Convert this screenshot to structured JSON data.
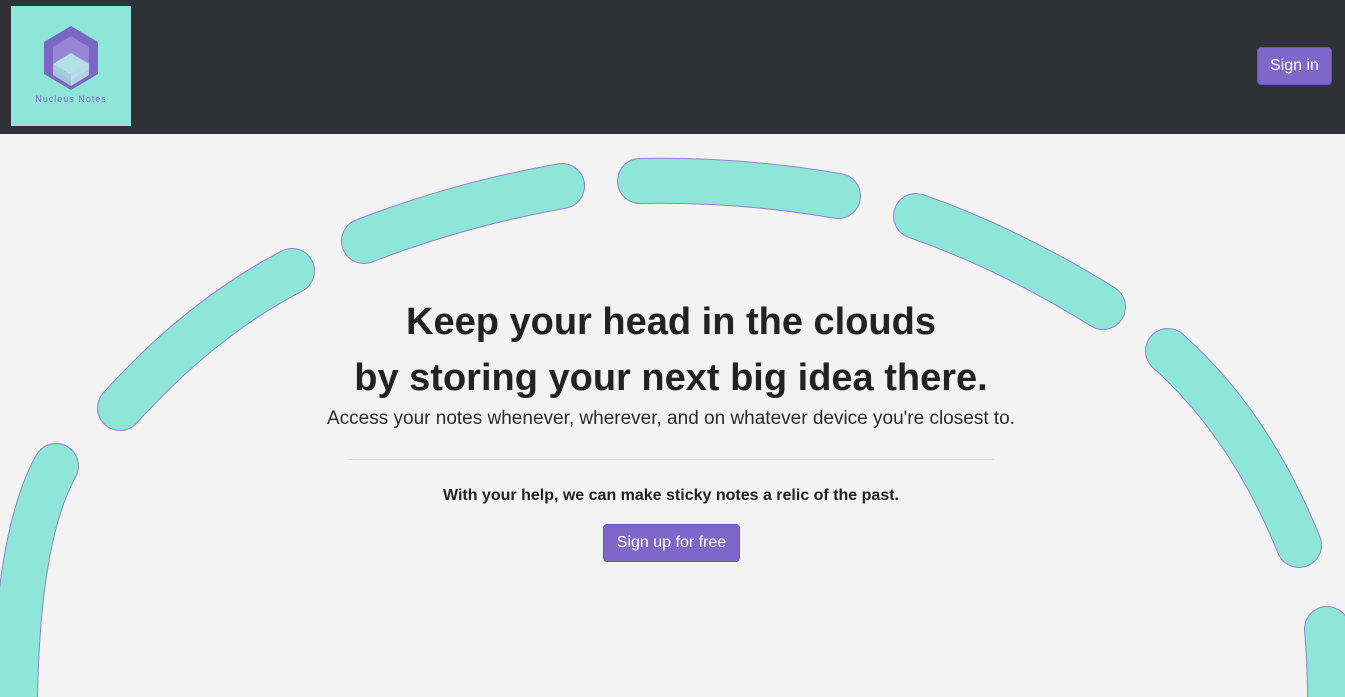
{
  "header": {
    "logo_text": "Nucleus Notes",
    "signin_label": "Sign in"
  },
  "hero": {
    "headline_line1": "Keep your head in the clouds",
    "headline_line2": "by storing your next big idea there.",
    "subline": "Access your notes whenever, wherever, and on whatever device you're closest to.",
    "tagline": "With your help, we can make sticky notes a relic of the past.",
    "signup_label": "Sign up for free"
  },
  "colors": {
    "navbar": "#2e3136",
    "accent_purple": "#7d68c9",
    "mint": "#8ee6d8",
    "background": "#f3f3f3"
  },
  "icons": {
    "logo": "hexagon-cube-icon"
  }
}
